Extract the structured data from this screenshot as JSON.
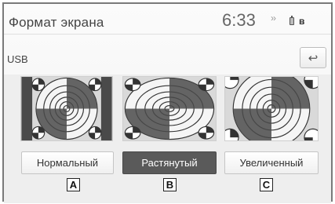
{
  "header": {
    "title": "Формат экрана",
    "time": "6:33",
    "status_text": "››",
    "bluetooth_glyph": "ʙ"
  },
  "source_label": "USB",
  "back_icon": "↩",
  "modes": [
    {
      "label": "Нормальный",
      "marker": "A",
      "selected": false
    },
    {
      "label": "Растянутый",
      "marker": "B",
      "selected": true
    },
    {
      "label": "Увеличенный",
      "marker": "C",
      "selected": false
    }
  ],
  "colors": {
    "selected_button": "#5a5a5a",
    "background": "#eeeeee"
  }
}
